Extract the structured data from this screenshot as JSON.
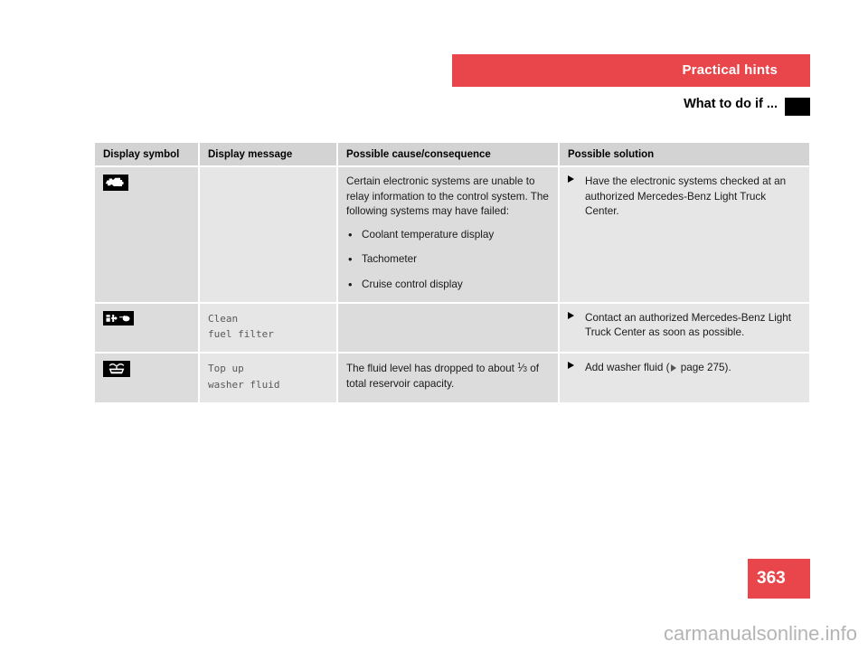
{
  "header": {
    "section_title": "Practical hints",
    "subsection_title": "What to do if ...",
    "bar_color": "#e8464a",
    "tab_marker_color": "#000000"
  },
  "table": {
    "columns": [
      {
        "key": "display_symbol",
        "label": "Display symbol"
      },
      {
        "key": "display_message",
        "label": "Display message"
      },
      {
        "key": "possible_cause",
        "label": "Possible cause/consequence"
      },
      {
        "key": "possible_solution",
        "label": "Possible solution"
      }
    ],
    "rows": [
      {
        "symbol_icon": "check-engine-icon",
        "display_message": "",
        "cause_intro": "Certain electronic systems are unable to relay information to the control system. The following systems may have failed:",
        "cause_bullets": [
          "Coolant temperature display",
          "Tachometer",
          "Cruise control display"
        ],
        "solution_text": "Have the electronic systems checked at an authorized Mercedes-Benz Light Truck Center."
      },
      {
        "symbol_icon": "fuel-filter-icon",
        "display_message": "Clean\nfuel filter",
        "cause_intro": "",
        "cause_bullets": [],
        "solution_text": "Contact an authorized Mercedes-Benz Light Truck Center as soon as possible."
      },
      {
        "symbol_icon": "washer-fluid-icon",
        "display_message": "Top up\nwasher fluid",
        "cause_text_before_fraction": "The fluid level has dropped to about ",
        "fraction_numerator": "1",
        "fraction_denominator": "3",
        "cause_text_after_fraction": " of total reservoir capacity.",
        "solution_prefix": "Add washer fluid (",
        "solution_reference": " page 275",
        "solution_suffix": ")."
      }
    ]
  },
  "footer": {
    "page_number": "363",
    "page_number_bg": "#e8464a",
    "watermark": "carmanualsonline.info"
  }
}
